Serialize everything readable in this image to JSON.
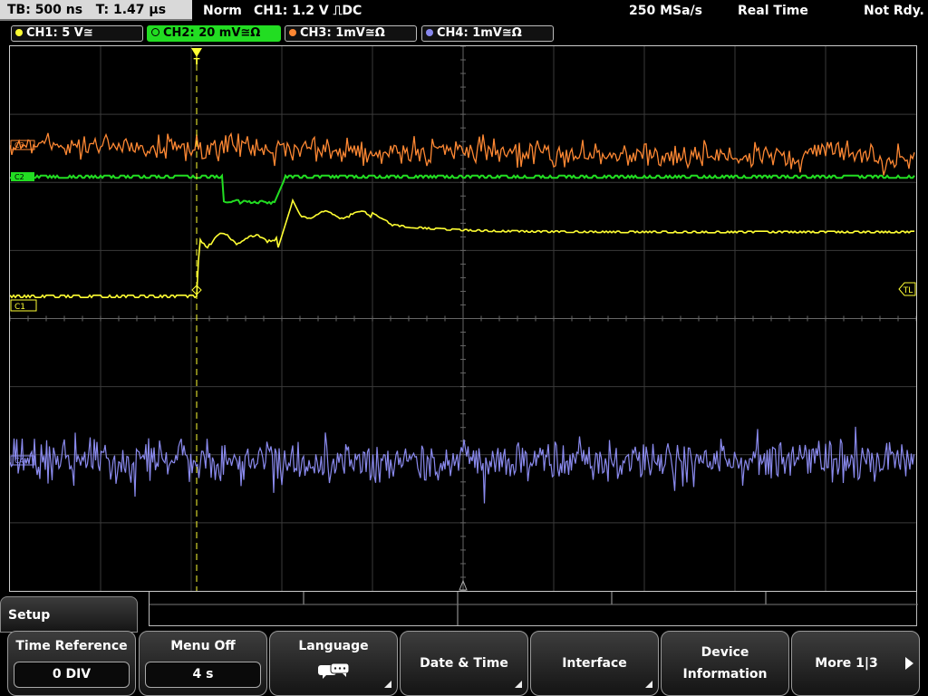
{
  "status": {
    "timebase": "TB: 500 ns",
    "trigger_time": "T: 1.47 µs",
    "trigger_mode": "Norm",
    "trigger_source": "CH1: 1.2 V ⎍DC",
    "sample_rate": "250 MSa/s",
    "acq_mode": "Real Time",
    "state": "Not Rdy."
  },
  "channels": [
    {
      "label": "CH1: 5 V≅",
      "color": "#ffff33",
      "active": false
    },
    {
      "label": "CH2: 20 mV≅Ω",
      "color": "#22dd22",
      "active": true
    },
    {
      "label": "CH3: 1mV≅Ω",
      "color": "#ff8833",
      "active": false
    },
    {
      "label": "CH4: 1mV≅Ω",
      "color": "#8888ee",
      "active": false
    }
  ],
  "markers": {
    "trigger": "T",
    "trigger_level": "TL",
    "ch1": "C1",
    "ch2": "C2",
    "ch3": "C3",
    "ch4": "C4"
  },
  "menu": {
    "title": "Setup",
    "softkeys": [
      {
        "label": "Time Reference",
        "value": "0 DIV"
      },
      {
        "label": "Menu Off",
        "value": "4 s"
      },
      {
        "label": "Language",
        "icon": "speech-bubbles-icon"
      },
      {
        "label": "Date & Time"
      },
      {
        "label": "Interface"
      },
      {
        "label": "Device\nInformation"
      },
      {
        "label": "More 1|3",
        "icon": "play-arrow-icon"
      }
    ]
  }
}
